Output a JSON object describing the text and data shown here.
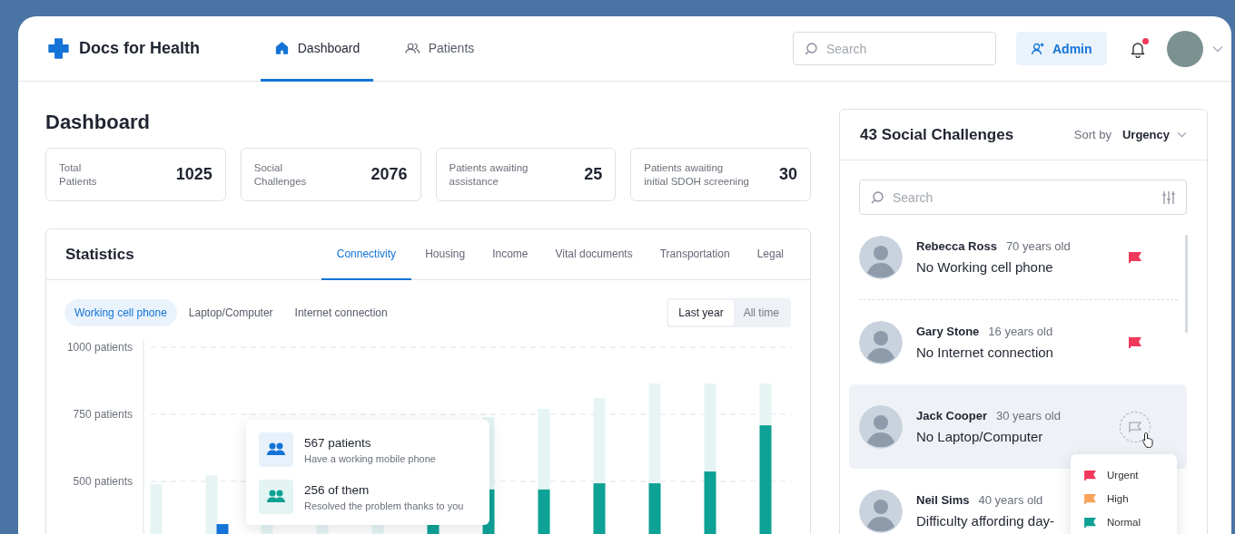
{
  "brand": {
    "name": "Docs for Health"
  },
  "nav": [
    {
      "label": "Dashboard",
      "selected": true
    },
    {
      "label": "Patients",
      "selected": false
    }
  ],
  "search": {
    "placeholder": "Search"
  },
  "admin_button": {
    "label": "Admin"
  },
  "notifications": {
    "unread": true
  },
  "page_title": "Dashboard",
  "stats": [
    {
      "label_lines": [
        "Total",
        "Patients"
      ],
      "value": "1025"
    },
    {
      "label_lines": [
        "Social",
        "Challenges"
      ],
      "value": "2076"
    },
    {
      "label_lines": [
        "Patients awaiting",
        "assistance"
      ],
      "value": "25"
    },
    {
      "label_lines": [
        "Patients awaiting",
        "initial SDOH screening"
      ],
      "value": "30"
    }
  ],
  "statistics": {
    "title": "Statistics",
    "tabs": [
      {
        "label": "Connectivity",
        "selected": true
      },
      {
        "label": "Housing",
        "selected": false
      },
      {
        "label": "Income",
        "selected": false
      },
      {
        "label": "Vital documents",
        "selected": false
      },
      {
        "label": "Transportation",
        "selected": false
      },
      {
        "label": "Legal",
        "selected": false
      }
    ],
    "filters": [
      {
        "label": "Working cell phone",
        "selected": true
      },
      {
        "label": "Laptop/Computer",
        "selected": false
      },
      {
        "label": "Internet connection",
        "selected": false
      }
    ],
    "periods": [
      {
        "label": "Last year",
        "selected": true
      },
      {
        "label": "All time",
        "selected": false
      }
    ],
    "y_axis_labels": [
      "1000 patients",
      "750 patients",
      "500 patients"
    ],
    "tooltip": [
      {
        "kind": "total",
        "value": "567 patients",
        "caption": "Have a working mobile phone"
      },
      {
        "kind": "resolved",
        "value": "256 of them",
        "caption": "Resolved the problem thanks to you"
      }
    ]
  },
  "challenges": {
    "title": "43 Social Challenges",
    "sort_label": "Sort by",
    "sort_value": "Urgency",
    "search": {
      "placeholder": "Search"
    },
    "items": [
      {
        "name": "Rebecca Ross",
        "age": "70 years old",
        "issue": "No Working cell phone",
        "kind": "flagged",
        "selected": false
      },
      {
        "name": "Gary Stone",
        "age": "16 years old",
        "issue": "No Internet connection",
        "kind": "flagged",
        "selected": false
      },
      {
        "name": "Jack Cooper",
        "age": "30 years old",
        "issue": "No Laptop/Computer",
        "kind": "unflagged",
        "selected": true
      },
      {
        "name": "Neil Sims",
        "age": "40 years old",
        "issue": "Difficulty affording day-",
        "kind": "plain",
        "selected": false
      }
    ],
    "priority_menu": [
      {
        "label": "Urgent",
        "color": "#f0385a"
      },
      {
        "label": "High",
        "color": "#f9a25c"
      },
      {
        "label": "Normal",
        "color": "#0ea195"
      }
    ]
  }
}
